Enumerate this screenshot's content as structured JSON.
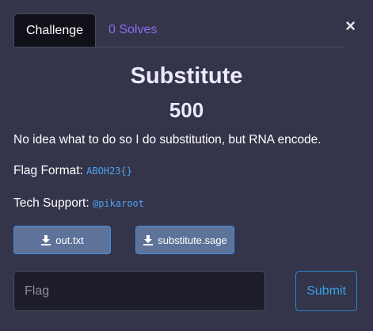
{
  "tabs": {
    "challenge_label": "Challenge",
    "solves_label": "0 Solves"
  },
  "close_icon": "×",
  "challenge": {
    "name": "Substitute",
    "points": "500",
    "description": "No idea what to do so I do substitution, but RNA encode.",
    "flag_format_label": "Flag Format:",
    "flag_format_value": "ABOH23{}",
    "support_label": "Tech Support:",
    "support_value": "@pikaroot"
  },
  "files": [
    {
      "label": "out.txt",
      "icon": "download-icon"
    },
    {
      "label": "substitute.sage",
      "icon": "download-icon"
    }
  ],
  "submission": {
    "placeholder": "Flag",
    "value": "",
    "submit_label": "Submit"
  },
  "colors": {
    "background": "#34344a",
    "accent_purple": "#8a6ef0",
    "code_blue": "#4fa3f0",
    "file_button": "#5e7399",
    "submit_border": "#2f87c8"
  }
}
